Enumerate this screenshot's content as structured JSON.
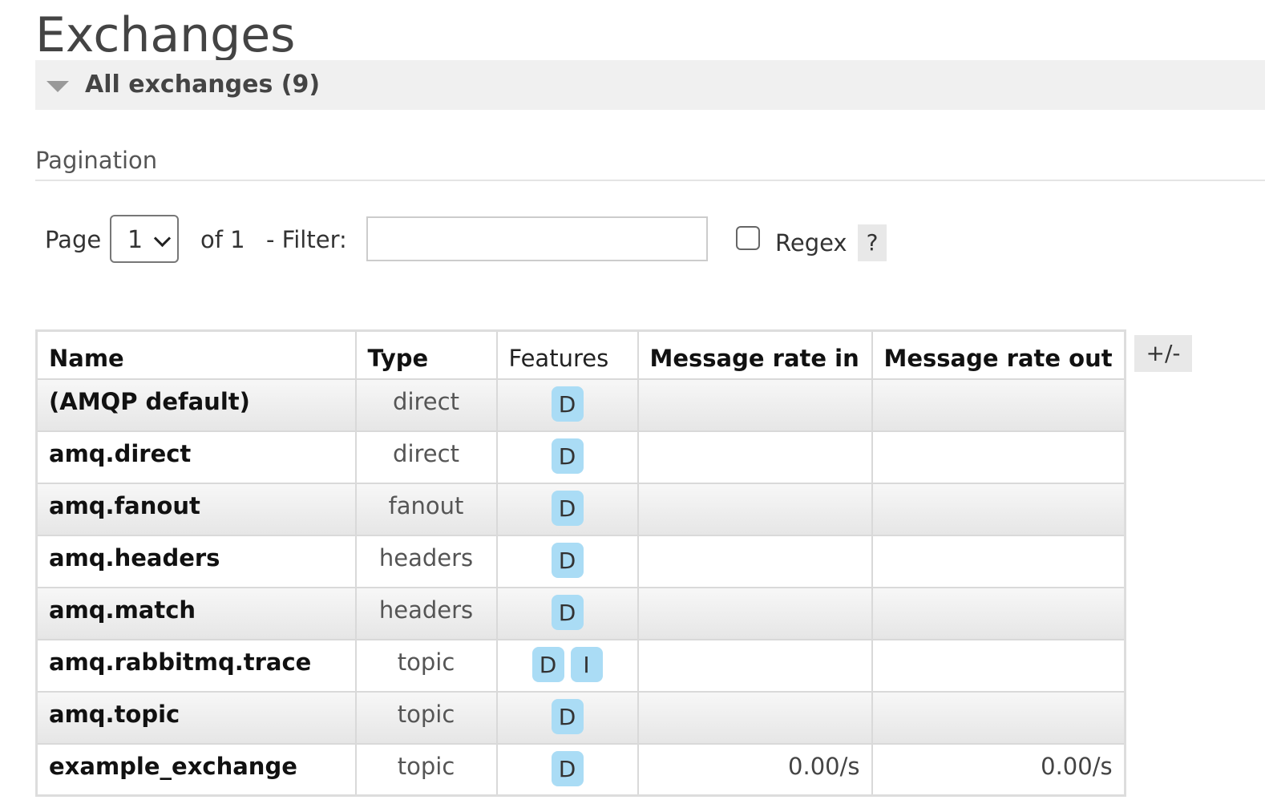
{
  "page": {
    "title": "Exchanges"
  },
  "section": {
    "title": "All exchanges (9)"
  },
  "pagination": {
    "heading": "Pagination",
    "page_label": "Page",
    "page_value": "1",
    "of_label": "of 1",
    "filter_label": "- Filter:",
    "filter_value": "",
    "regex_label": "Regex",
    "regex_checked": false,
    "help_label": "?"
  },
  "table": {
    "columns": [
      "Name",
      "Type",
      "Features",
      "Message rate in",
      "Message rate out"
    ],
    "toggle_columns_label": "+/-",
    "rows": [
      {
        "name": "(AMQP default)",
        "type": "direct",
        "features": [
          "D"
        ],
        "rate_in": "",
        "rate_out": ""
      },
      {
        "name": "amq.direct",
        "type": "direct",
        "features": [
          "D"
        ],
        "rate_in": "",
        "rate_out": ""
      },
      {
        "name": "amq.fanout",
        "type": "fanout",
        "features": [
          "D"
        ],
        "rate_in": "",
        "rate_out": ""
      },
      {
        "name": "amq.headers",
        "type": "headers",
        "features": [
          "D"
        ],
        "rate_in": "",
        "rate_out": ""
      },
      {
        "name": "amq.match",
        "type": "headers",
        "features": [
          "D"
        ],
        "rate_in": "",
        "rate_out": ""
      },
      {
        "name": "amq.rabbitmq.trace",
        "type": "topic",
        "features": [
          "D",
          "I"
        ],
        "rate_in": "",
        "rate_out": ""
      },
      {
        "name": "amq.topic",
        "type": "topic",
        "features": [
          "D"
        ],
        "rate_in": "",
        "rate_out": ""
      },
      {
        "name": "example_exchange",
        "type": "topic",
        "features": [
          "D"
        ],
        "rate_in": "0.00/s",
        "rate_out": "0.00/s"
      }
    ]
  },
  "colors": {
    "feature_badge": "#aadcf5",
    "header_band": "#f0f0f0",
    "row_alt": "#eeeeee"
  }
}
